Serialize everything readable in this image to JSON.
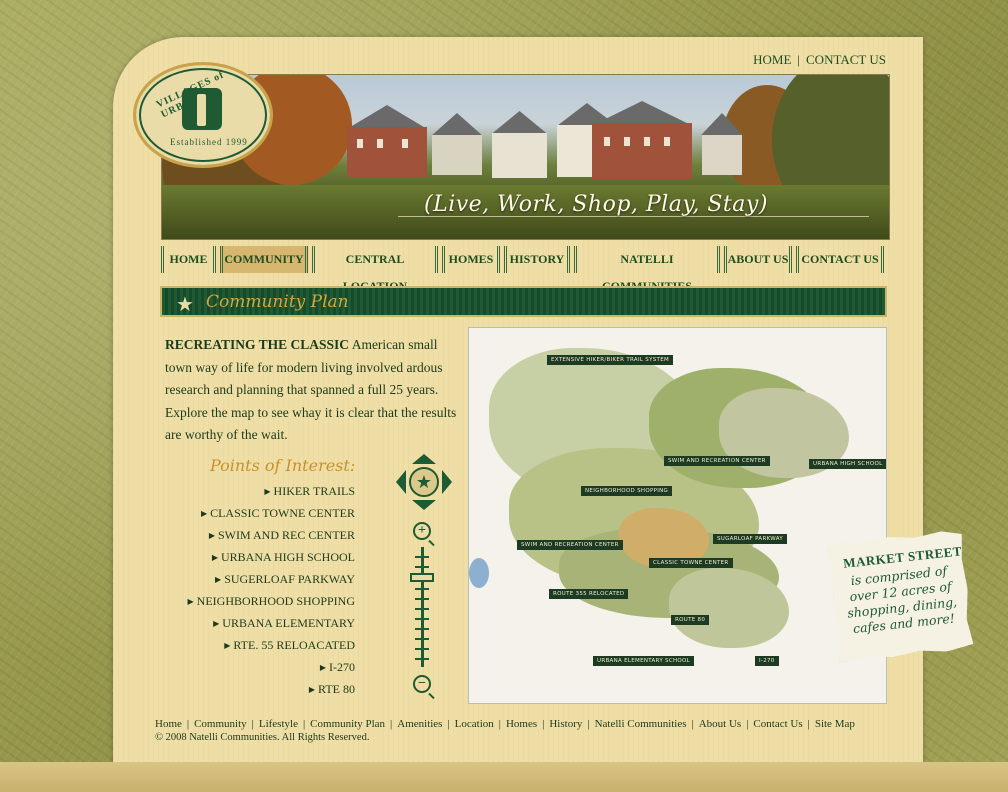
{
  "header": {
    "top_links": [
      "HOME",
      "CONTACT US"
    ],
    "logo": {
      "top_text": "VILLAGES of URBANA",
      "bottom_text": "Established 1999"
    },
    "slogan": "(Live, Work, Shop, Play, Stay)"
  },
  "nav": {
    "items": [
      {
        "label": "HOME",
        "active": false
      },
      {
        "label": "COMMUNITY",
        "active": true
      },
      {
        "label": "CENTRAL LOCATION",
        "active": false
      },
      {
        "label": "HOMES",
        "active": false
      },
      {
        "label": "HISTORY",
        "active": false
      },
      {
        "label": "NATELLI COMMUNITIES",
        "active": false
      },
      {
        "label": "ABOUT US",
        "active": false
      },
      {
        "label": "CONTACT US",
        "active": false
      }
    ]
  },
  "section": {
    "title": "Community Plan"
  },
  "intro": {
    "lead": "RECREATING THE CLASSIC",
    "body": " American small town way of life for modern living involved ardous research and planning that spanned a full 25 years. Explore the map to see whay it is clear that the results are worthy of the wait."
  },
  "poi": {
    "title": "Points of Interest:",
    "items": [
      "HIKER TRAILS",
      "CLASSIC TOWNE CENTER",
      "SWIM AND REC CENTER",
      "URBANA HIGH SCHOOL",
      "SUGERLOAF PARKWAY",
      "NEIGHBORHOOD SHOPPING",
      "URBANA ELEMENTARY",
      "RTE. 55 RELOACATED",
      "I-270",
      "RTE 80"
    ]
  },
  "map": {
    "labels": [
      "EXTENSIVE HIKER/BIKER TRAIL SYSTEM",
      "SWIM AND RECREATION CENTER",
      "URBANA HIGH SCHOOL",
      "NEIGHBORHOOD SHOPPING",
      "SWIM AND RECREATION CENTER",
      "SUGARLOAF PARKWAY",
      "CLASSIC TOWNE CENTER",
      "ROUTE 355 RELOCATED",
      "ROUTE 80",
      "URBANA ELEMENTARY SCHOOL",
      "I-270"
    ]
  },
  "note": {
    "heading": "MARKET STREET",
    "text": "is comprised of over 12 acres of shopping, dining, cafes and more!"
  },
  "footer": {
    "links": [
      "Home",
      "Community",
      "Lifestyle",
      "Community Plan",
      "Amenities",
      "Location",
      "Homes",
      "History",
      "Natelli Communities",
      "About Us",
      "Contact Us",
      "Site Map"
    ],
    "copyright": "© 2008 Natelli Communities. All Rights Reserved."
  },
  "colors": {
    "forest_green": "#1e5a33",
    "gold": "#d7a63c",
    "paper": "#efdfa6",
    "nav_active": "#d7b670"
  },
  "icons": [
    "star-icon",
    "pan-up-icon",
    "pan-down-icon",
    "pan-left-icon",
    "pan-right-icon",
    "zoom-in-icon",
    "zoom-out-icon"
  ]
}
